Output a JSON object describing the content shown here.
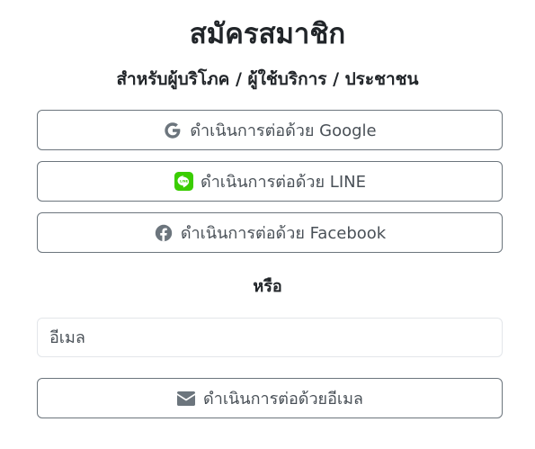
{
  "header": {
    "title": "สมัครสมาชิก",
    "subtitle": "สำหรับผู้บริโภค / ผู้ใช้บริการ / ประชาชน"
  },
  "social_buttons": [
    {
      "label": "ดำเนินการต่อด้วย Google",
      "icon": "google-icon",
      "color": "#6c757d"
    },
    {
      "label": "ดำเนินการต่อด้วย LINE",
      "icon": "line-icon",
      "color": "#3acd01"
    },
    {
      "label": "ดำเนินการต่อด้วย Facebook",
      "icon": "facebook-icon",
      "color": "#6c757d"
    }
  ],
  "divider": {
    "label": "หรือ"
  },
  "email": {
    "placeholder": "อีเมล",
    "value": ""
  },
  "email_button": {
    "label": "ดำเนินการต่อด้วยอีเมล",
    "icon": "envelope-icon"
  },
  "colors": {
    "button_border": "#6c757d",
    "input_border": "#e3e6ea",
    "text": "#212529"
  }
}
